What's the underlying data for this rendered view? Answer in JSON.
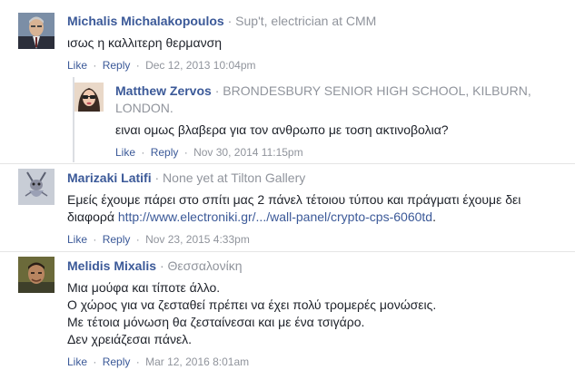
{
  "comments": [
    {
      "author": "Michalis Michalakopoulos",
      "separator": "·",
      "subtitle": "Sup't, electrician at CMM",
      "text": "ισως η καλλιτερη θερμανση",
      "like": "Like",
      "reply": "Reply",
      "dot": "·",
      "timestamp": "Dec 12, 2013 10:04pm",
      "reply_item": {
        "author": "Matthew Zervos",
        "separator": "·",
        "subtitle": "BRONDESBURY SENIOR HIGH SCHOOL, KILBURN, LONDON.",
        "text": "ειναι ομως βλαβερα για τον ανθρωπο με τοση ακτινοβολια?",
        "like": "Like",
        "reply": "Reply",
        "dot": "·",
        "timestamp": "Nov 30, 2014 11:15pm"
      }
    },
    {
      "author": "Marizaki Latifi",
      "separator": "·",
      "subtitle": "None yet at Tilton Gallery",
      "text": "Εμείς έχουμε πάρει στο σπίτι μας 2 πάνελ τέτοιου τύπου και πράγματι έχουμε δει διαφορά",
      "link": "http://www.electroniki.gr/.../wall-panel/crypto-cps-6060td",
      "text_end": ".",
      "like": "Like",
      "reply": "Reply",
      "dot": "·",
      "timestamp": "Nov 23, 2015 4:33pm"
    },
    {
      "author": "Melidis Mixalis",
      "separator": "·",
      "subtitle": "Θεσσαλονίκη",
      "lines": [
        "Μια μούφα και τίποτε άλλο.",
        "Ο χώρος για να ζεσταθεί πρέπει να έχει πολύ τρομερές μονώσεις.",
        "Με τέτοια μόνωση θα ζεσταίνεσαι και με ένα τσιγάρο.",
        "Δεν χρειάζεσαι πάνελ."
      ],
      "like": "Like",
      "reply": "Reply",
      "dot": "·",
      "timestamp": "Mar 12, 2016 8:01am"
    }
  ],
  "colors": {
    "author": "#3b5998",
    "meta": "#90949c",
    "text": "#1d2129",
    "divider": "#e5e5e5"
  }
}
